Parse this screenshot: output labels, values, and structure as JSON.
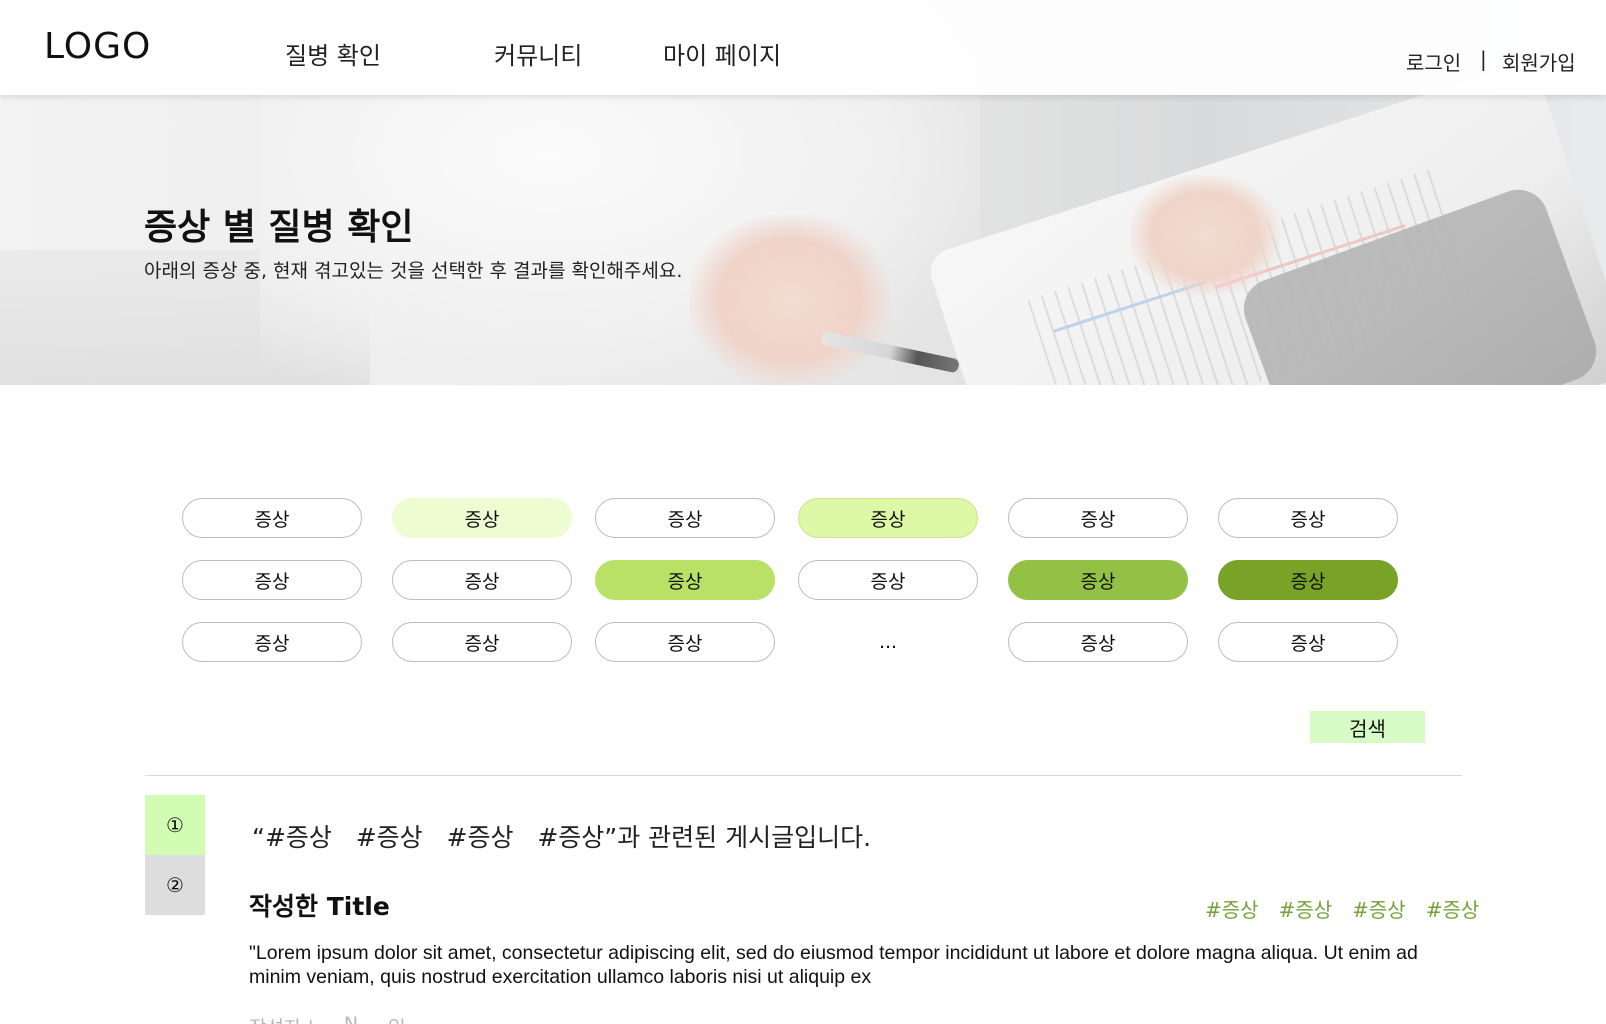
{
  "header": {
    "logo": "LOGO",
    "nav": [
      "질병 확인",
      "커뮤니티",
      "마이 페이지"
    ],
    "login": "로그인",
    "separator": "|",
    "signup": "회원가입"
  },
  "hero": {
    "title": "증상 별 질병 확인",
    "subtitle": "아래의 증상 중, 현재 겪고있는 것을 선택한 후 결과를 확인해주세요."
  },
  "symptoms": {
    "rows": [
      [
        "증상",
        "증상",
        "증상",
        "증상",
        "증상",
        "증상"
      ],
      [
        "증상",
        "증상",
        "증상",
        "증상",
        "증상",
        "증상"
      ],
      [
        "증상",
        "증상",
        "증상",
        "...",
        "증상",
        "증상"
      ]
    ],
    "colors": {
      "level1": "#eefcd2",
      "level2": "#ddf8a6",
      "level3": "#b8e165",
      "level4": "#93c146",
      "level5": "#78a326"
    }
  },
  "search": {
    "label": "검색",
    "color": "#d6fbc4"
  },
  "pagination": {
    "pages": [
      "①",
      "②"
    ],
    "active": 1,
    "active_color": "#d2fbb3"
  },
  "results": {
    "heading": "“#증상   #증상   #증상   #증상”과 관련된 게시글입니다.",
    "post": {
      "title": "작성한 Title",
      "tags": [
        "#증상",
        "#증상",
        "#증상",
        "#증상"
      ],
      "body": "\"Lorem ipsum dolor sit amet, consectetur adipiscing elit, sed do eiusmod tempor incididunt ut labore et dolore magna aliqua. Ut enim ad minim veniam, quis nostrud exercitation ullamco laboris nisi ut aliquip ex",
      "meta": [
        "작성자 |",
        "N",
        "일"
      ]
    },
    "tag_color": "#74a238"
  }
}
